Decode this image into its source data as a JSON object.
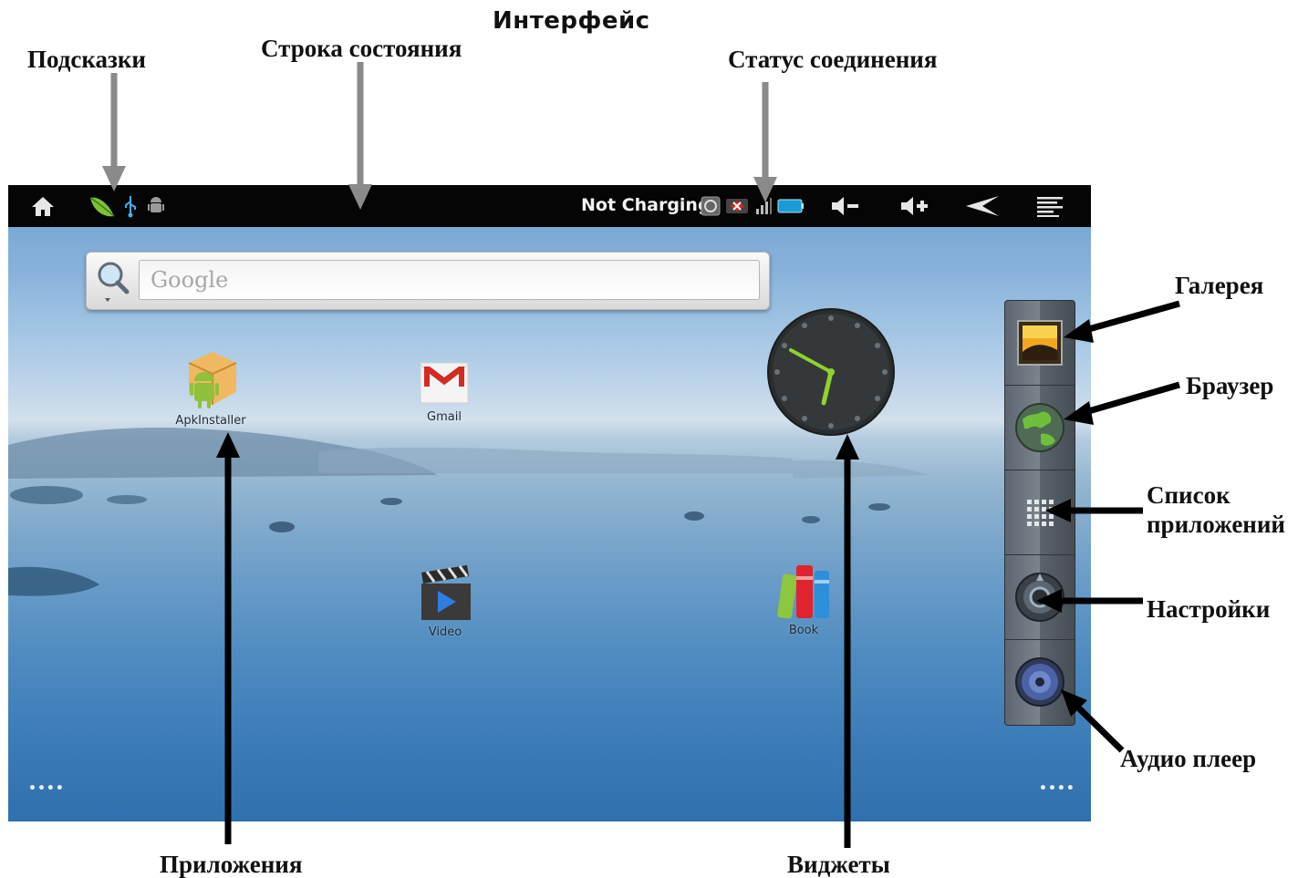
{
  "heading": "Интерфейс",
  "callouts": {
    "hints": "Подсказки",
    "status_bar": "Строка состояния",
    "connection_status": "Статус соединения",
    "gallery": "Галерея",
    "browser": "Браузер",
    "app_list_line1": "Список",
    "app_list_line2": "приложений",
    "settings": "Настройки",
    "audio_player": "Аудио плеер",
    "apps": "Приложения",
    "widgets": "Виджеты"
  },
  "statusbar": {
    "charging": "Not Charging",
    "icons": [
      "home-icon",
      "notification-leaf-icon",
      "usb-icon",
      "android-debug-icon",
      "sync-icon",
      "no-connection-icon",
      "signal-icon",
      "battery-icon",
      "volume-down-icon",
      "volume-up-icon",
      "back-icon",
      "menu-icon"
    ]
  },
  "search": {
    "placeholder": "Google"
  },
  "apps": {
    "apkinstaller": "ApkInstaller",
    "gmail": "Gmail",
    "video": "Video",
    "book": "Book"
  },
  "pager": {
    "left": "••••",
    "right": "••••"
  },
  "dock": [
    "gallery-icon",
    "browser-icon",
    "app-list-icon",
    "settings-icon",
    "audio-player-icon"
  ],
  "colors": {
    "statusbar_bg": "#050505",
    "sky": "#89b3db",
    "water": "#3c7cb8",
    "clock_hand": "#8fd22c"
  }
}
